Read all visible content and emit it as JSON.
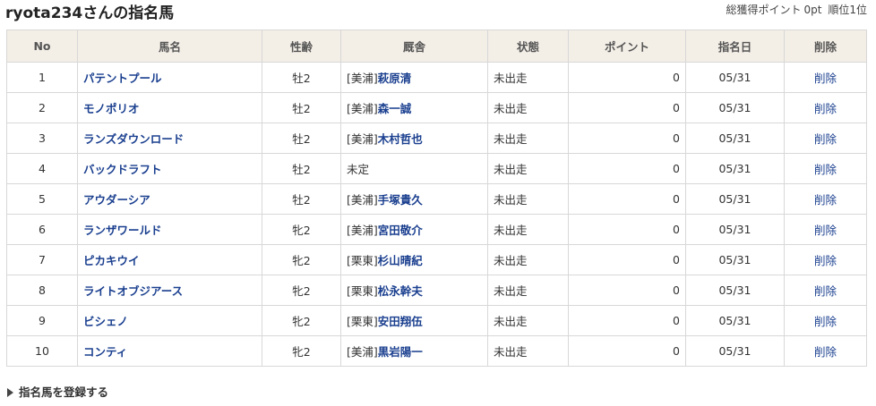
{
  "header": {
    "title": "ryota234さんの指名馬",
    "points_label": "総獲得ポイント",
    "points_value": "0pt",
    "rank_label": "順位",
    "rank_value": "1位"
  },
  "table": {
    "columns": [
      "No",
      "馬名",
      "性齢",
      "厩舎",
      "状態",
      "ポイント",
      "指名日",
      "削除"
    ],
    "rows": [
      {
        "no": "1",
        "horse": "パテントプール",
        "sexage": "牡2",
        "region": "[美浦]",
        "trainer": "萩原清",
        "status": "未出走",
        "points": "0",
        "date": "05/31",
        "delete": "削除"
      },
      {
        "no": "2",
        "horse": "モノポリオ",
        "sexage": "牡2",
        "region": "[美浦]",
        "trainer": "森一誠",
        "status": "未出走",
        "points": "0",
        "date": "05/31",
        "delete": "削除"
      },
      {
        "no": "3",
        "horse": "ランズダウンロード",
        "sexage": "牡2",
        "region": "[美浦]",
        "trainer": "木村哲也",
        "status": "未出走",
        "points": "0",
        "date": "05/31",
        "delete": "削除"
      },
      {
        "no": "4",
        "horse": "バックドラフト",
        "sexage": "牡2",
        "region": "",
        "trainer": "未定",
        "status": "未出走",
        "points": "0",
        "date": "05/31",
        "delete": "削除"
      },
      {
        "no": "5",
        "horse": "アウダーシア",
        "sexage": "牡2",
        "region": "[美浦]",
        "trainer": "手塚貴久",
        "status": "未出走",
        "points": "0",
        "date": "05/31",
        "delete": "削除"
      },
      {
        "no": "6",
        "horse": "ランザワールド",
        "sexage": "牝2",
        "region": "[美浦]",
        "trainer": "宮田敬介",
        "status": "未出走",
        "points": "0",
        "date": "05/31",
        "delete": "削除"
      },
      {
        "no": "7",
        "horse": "ピカキウイ",
        "sexage": "牝2",
        "region": "[栗東]",
        "trainer": "杉山晴紀",
        "status": "未出走",
        "points": "0",
        "date": "05/31",
        "delete": "削除"
      },
      {
        "no": "8",
        "horse": "ライトオブジアース",
        "sexage": "牝2",
        "region": "[栗東]",
        "trainer": "松永幹夫",
        "status": "未出走",
        "points": "0",
        "date": "05/31",
        "delete": "削除"
      },
      {
        "no": "9",
        "horse": "ビシェノ",
        "sexage": "牝2",
        "region": "[栗東]",
        "trainer": "安田翔伍",
        "status": "未出走",
        "points": "0",
        "date": "05/31",
        "delete": "削除"
      },
      {
        "no": "10",
        "horse": "コンティ",
        "sexage": "牝2",
        "region": "[美浦]",
        "trainer": "黒岩陽一",
        "status": "未出走",
        "points": "0",
        "date": "05/31",
        "delete": "削除"
      }
    ]
  },
  "footer": {
    "register_label": "指名馬を登録する",
    "register_icon": "triangle-right-icon"
  }
}
